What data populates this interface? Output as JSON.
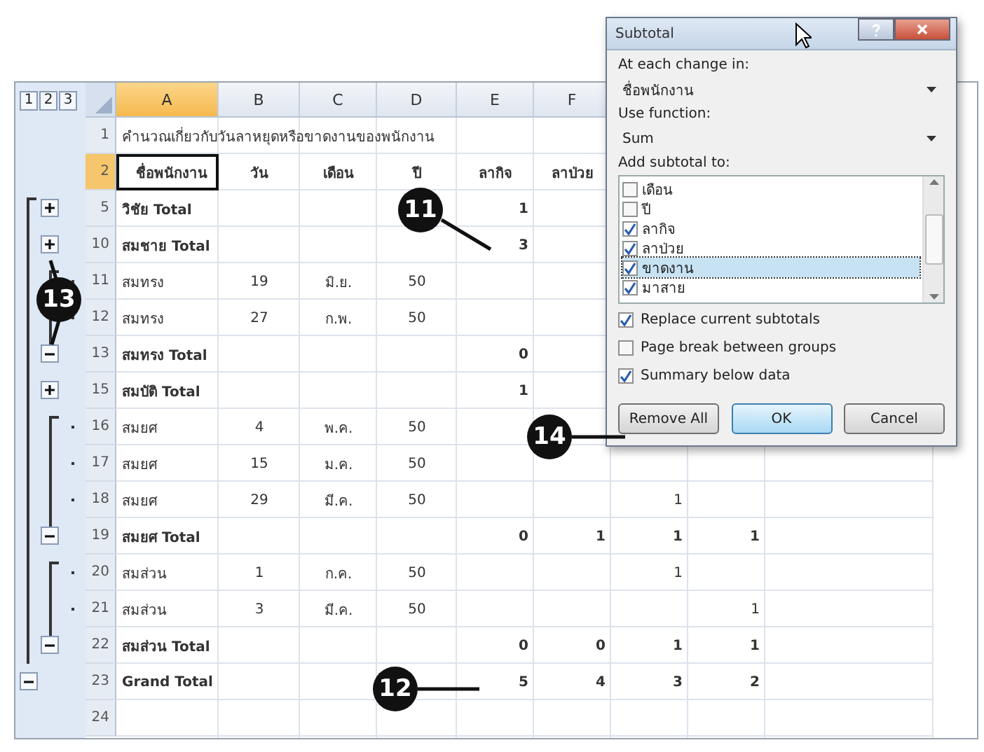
{
  "outline_levels": [
    "1",
    "2",
    "3"
  ],
  "columns": [
    {
      "label": "A",
      "selected": true
    },
    {
      "label": "B",
      "selected": false
    },
    {
      "label": "C",
      "selected": false
    },
    {
      "label": "D",
      "selected": false
    },
    {
      "label": "E",
      "selected": false
    },
    {
      "label": "F",
      "selected": false
    }
  ],
  "rows": [
    {
      "num": "1",
      "kind": "title",
      "selected": false,
      "cells": {
        "A": "คำนวณเกี่ยวกับวันลาหยุดหรือขาดงานของพนักงาน"
      }
    },
    {
      "num": "2",
      "kind": "header",
      "selected": true,
      "cells": {
        "A": "ชื่อพนักงาน",
        "B": "วัน",
        "C": "เดือน",
        "D": "ปี",
        "E": "ลากิจ",
        "F": "ลาป่วย"
      }
    },
    {
      "num": "5",
      "kind": "collapsed_total",
      "selected": false,
      "cells": {
        "A": "วิชัย Total",
        "E": "1"
      }
    },
    {
      "num": "10",
      "kind": "collapsed_total",
      "selected": false,
      "cells": {
        "A": "สมชาย Total",
        "E": "3"
      }
    },
    {
      "num": "11",
      "kind": "detail",
      "selected": false,
      "cells": {
        "A": "สมทรง",
        "B": "19",
        "C": "มิ.ย.",
        "D": "50"
      }
    },
    {
      "num": "12",
      "kind": "detail",
      "selected": false,
      "cells": {
        "A": "สมทรง",
        "B": "27",
        "C": "ก.พ.",
        "D": "50"
      }
    },
    {
      "num": "13",
      "kind": "expanded_total",
      "selected": false,
      "cells": {
        "A": "สมทรง Total",
        "E": "0"
      }
    },
    {
      "num": "15",
      "kind": "collapsed_total",
      "selected": false,
      "cells": {
        "A": "สมบัติ Total",
        "E": "1"
      }
    },
    {
      "num": "16",
      "kind": "detail",
      "selected": false,
      "cells": {
        "A": "สมยศ",
        "B": "4",
        "C": "พ.ค.",
        "D": "50"
      }
    },
    {
      "num": "17",
      "kind": "detail",
      "selected": false,
      "cells": {
        "A": "สมยศ",
        "B": "15",
        "C": "ม.ค.",
        "D": "50"
      }
    },
    {
      "num": "18",
      "kind": "detail",
      "selected": false,
      "cells": {
        "A": "สมยศ",
        "B": "29",
        "C": "มี.ค.",
        "D": "50",
        "G": "1"
      }
    },
    {
      "num": "19",
      "kind": "expanded_total",
      "selected": false,
      "cells": {
        "A": "สมยศ Total",
        "E": "0",
        "F": "1",
        "G": "1",
        "H": "1"
      }
    },
    {
      "num": "20",
      "kind": "detail",
      "selected": false,
      "cells": {
        "A": "สมส่วน",
        "B": "1",
        "C": "ก.ค.",
        "D": "50",
        "G": "1"
      }
    },
    {
      "num": "21",
      "kind": "detail",
      "selected": false,
      "cells": {
        "A": "สมส่วน",
        "B": "3",
        "C": "มี.ค.",
        "D": "50",
        "H": "1"
      }
    },
    {
      "num": "22",
      "kind": "expanded_total",
      "selected": false,
      "cells": {
        "A": "สมส่วน Total",
        "E": "0",
        "F": "0",
        "G": "1",
        "H": "1"
      }
    },
    {
      "num": "23",
      "kind": "grand_total",
      "selected": false,
      "cells": {
        "A": "Grand Total",
        "E": "5",
        "F": "4",
        "G": "3",
        "H": "2"
      }
    },
    {
      "num": "24",
      "kind": "empty",
      "selected": false,
      "cells": {}
    }
  ],
  "dialog": {
    "title": "Subtotal",
    "change_label": "At each change in:",
    "change_value": "ชื่อพนักงาน",
    "function_label": "Use function:",
    "function_value": "Sum",
    "add_label": "Add subtotal to:",
    "add_items": [
      {
        "label": "เดือน",
        "checked": false,
        "selected": false
      },
      {
        "label": "ปี",
        "checked": false,
        "selected": false
      },
      {
        "label": "ลากิจ",
        "checked": true,
        "selected": false
      },
      {
        "label": "ลาป่วย",
        "checked": true,
        "selected": false
      },
      {
        "label": "ขาดงาน",
        "checked": true,
        "selected": true
      },
      {
        "label": "มาสาย",
        "checked": true,
        "selected": false
      }
    ],
    "options": [
      {
        "label": "Replace current subtotals",
        "checked": true
      },
      {
        "label": "Page break between groups",
        "checked": false
      },
      {
        "label": "Summary below data",
        "checked": true
      }
    ],
    "buttons": [
      {
        "label": "Remove All",
        "default": false
      },
      {
        "label": "OK",
        "default": true
      },
      {
        "label": "Cancel",
        "default": false
      }
    ]
  },
  "callouts": [
    {
      "label": "11"
    },
    {
      "label": "12"
    },
    {
      "label": "13"
    },
    {
      "label": "14"
    }
  ]
}
